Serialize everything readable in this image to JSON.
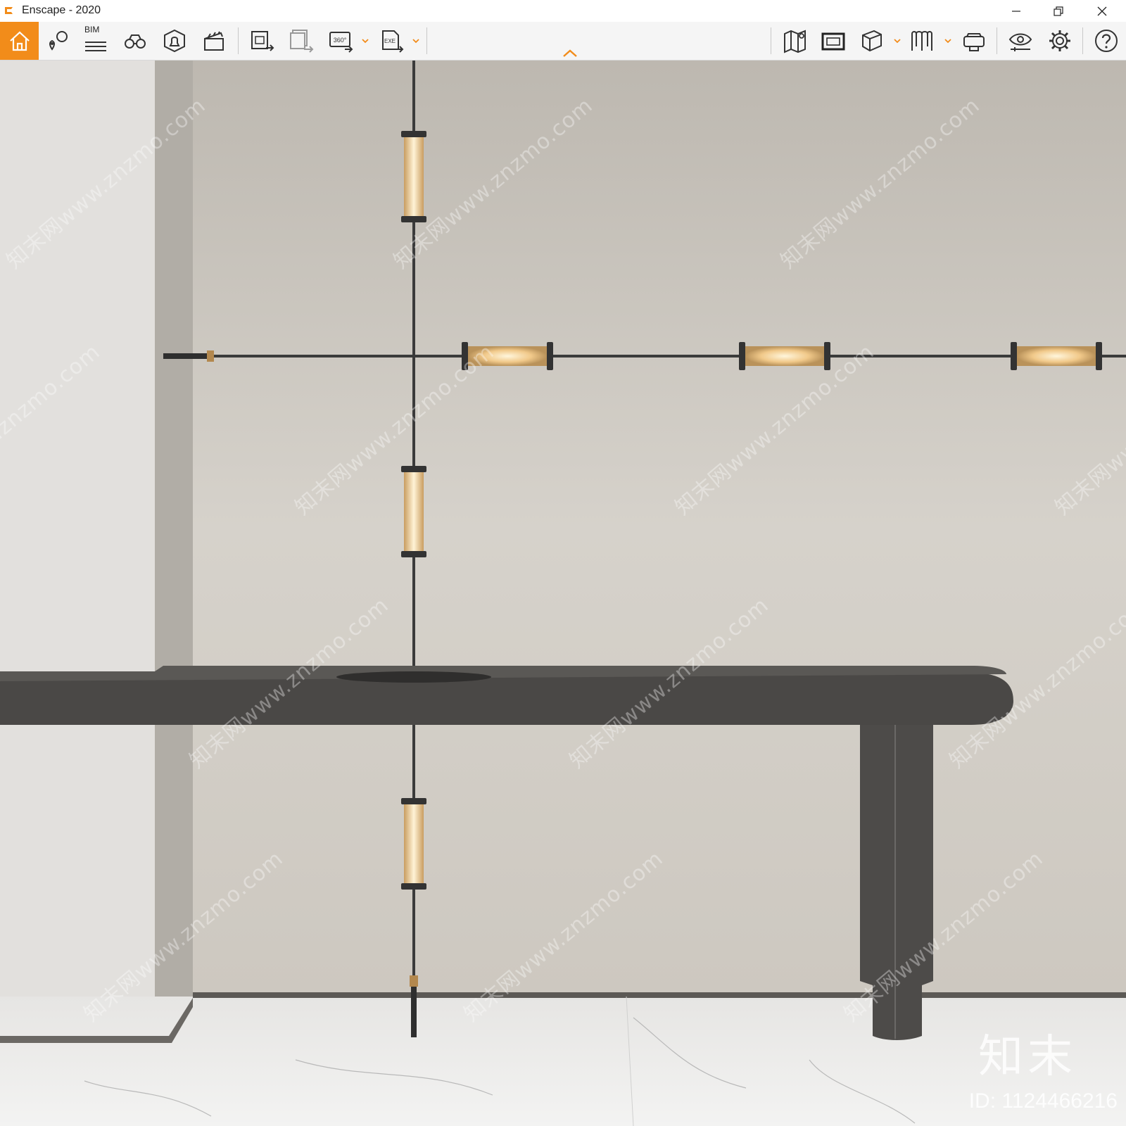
{
  "window": {
    "title": "Enscape - 2020",
    "minimize_icon": "minimize-icon",
    "restore_icon": "restore-icon",
    "close_icon": "close-icon"
  },
  "toolbar": {
    "bim_label": "BIM",
    "buttons_left": [
      "home-icon",
      "location-pin-icon",
      "bim-list-icon",
      "binoculars-icon",
      "bell-icon",
      "clapperboard-icon"
    ],
    "buttons_export": [
      "screenshot-export-icon",
      "batch-render-icon",
      "panorama-360-icon",
      "exe-export-icon"
    ],
    "export_labels": {
      "panorama": "360°",
      "exe": "EXE"
    },
    "buttons_right": [
      "map-icon",
      "asset-library-icon",
      "cube-icon",
      "bookmark-icon",
      "vr-headset-icon",
      "eye-icon",
      "gear-icon",
      "help-icon"
    ],
    "accent_color": "#f28c1a"
  },
  "viewport": {
    "watermark_text": "知末网www.znzmo.com",
    "brand_text": "知末",
    "image_id": "ID: 1124466216"
  }
}
